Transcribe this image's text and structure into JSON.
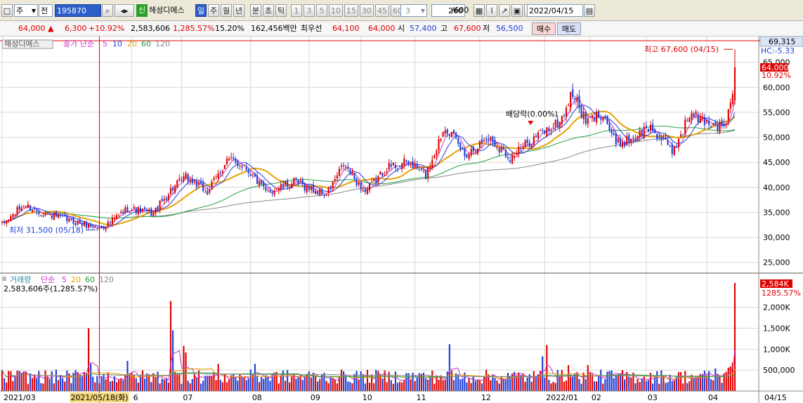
{
  "toolbar": {
    "market": "주",
    "prev_label": "전",
    "code": "195870",
    "badge": "신",
    "name": "해성디에스",
    "periods": [
      "일",
      "주",
      "월",
      "년",
      "분",
      "초",
      "틱"
    ],
    "intervals": [
      "1",
      "3",
      "5",
      "10",
      "15",
      "30",
      "45",
      "60"
    ],
    "count_select": "3",
    "view_count": "260",
    "view_total": "/600",
    "date": "2022/04/15"
  },
  "quote": {
    "price": "64,000",
    "change_arrow": "▲",
    "change": "6,300",
    "change_pct": "+10.92%",
    "volume": "2,583,606",
    "volume_pct": "1,285.57%",
    "turnover": "15.20%",
    "amount": "162,456백만",
    "best_label": "최우선",
    "best_ask": "64,100",
    "best_bid": "64,000",
    "open_label": "시",
    "open": "57,400",
    "high_label": "고",
    "high": "67,600",
    "low_label": "저",
    "low": "56,500",
    "buy": "매수",
    "sell": "매도"
  },
  "colors": {
    "up": "#e00000",
    "down": "#1f3fd6",
    "ma5": "#cc33cc",
    "ma10": "#1f3fd6",
    "ma20": "#e8a000",
    "ma60": "#22a040",
    "ma120": "#888888",
    "highlight": "#e00000"
  },
  "price_panel": {
    "legend_name": "해성디에스",
    "legend_type": "종가 단순",
    "ma_periods": [
      "5",
      "10",
      "20",
      "60",
      "120"
    ],
    "hover_label": "69,315",
    "hc_label": "HC:-5.33",
    "last_label": "64,000",
    "last_pct": "10.92%",
    "high_annotation": "최고 67,600 (04/15)",
    "low_annotation": "최저 31,500 (05/18)",
    "dividend_annotation": "배당락(0.00%)"
  },
  "volume_panel": {
    "legend_name": "거래량",
    "legend_type": "단순",
    "ma_periods": [
      "5",
      "20",
      "60",
      "120"
    ],
    "value_text": "2,583,606주(1,285.57%)",
    "last_label": "2,584K",
    "last_pct": "1285.57%"
  },
  "x_axis": {
    "highlight_date": "2021/05/18(화)",
    "end_label": "04/15"
  },
  "chart_data": {
    "type": "candlestick",
    "title": "해성디에스",
    "y_axis": {
      "ticks": [
        25000,
        30000,
        35000,
        40000,
        45000,
        50000,
        55000,
        60000,
        65000
      ],
      "labels": [
        "25,000",
        "30,000",
        "35,000",
        "40,000",
        "45,000",
        "50,000",
        "55,000",
        "60,000",
        "65,000"
      ],
      "ylim": [
        23000,
        69315
      ]
    },
    "x_axis_labels": [
      {
        "label": "2021/03",
        "index": 0
      },
      {
        "label": "6",
        "index": 60
      },
      {
        "label": "07",
        "index": 83
      },
      {
        "label": "08",
        "index": 115
      },
      {
        "label": "09",
        "index": 142
      },
      {
        "label": "10",
        "index": 166
      },
      {
        "label": "11",
        "index": 191
      },
      {
        "label": "12",
        "index": 221
      },
      {
        "label": "2022/01",
        "index": 251
      },
      {
        "label": "02",
        "index": 272
      },
      {
        "label": "03",
        "index": 298
      },
      {
        "label": "04",
        "index": 326
      }
    ],
    "highlight_index": 45,
    "dividend_index": 251,
    "anchors": [
      [
        0,
        32500
      ],
      [
        10,
        36500
      ],
      [
        18,
        35000
      ],
      [
        30,
        33500
      ],
      [
        45,
        31800
      ],
      [
        50,
        33000
      ],
      [
        58,
        35800
      ],
      [
        70,
        34800
      ],
      [
        78,
        39500
      ],
      [
        85,
        42000
      ],
      [
        95,
        39000
      ],
      [
        104,
        45500
      ],
      [
        112,
        44500
      ],
      [
        122,
        39000
      ],
      [
        135,
        41000
      ],
      [
        150,
        38500
      ],
      [
        158,
        44500
      ],
      [
        168,
        39000
      ],
      [
        178,
        44000
      ],
      [
        188,
        45000
      ],
      [
        196,
        42500
      ],
      [
        205,
        52500
      ],
      [
        214,
        46500
      ],
      [
        225,
        50000
      ],
      [
        235,
        46000
      ],
      [
        248,
        50500
      ],
      [
        258,
        53000
      ],
      [
        264,
        59000
      ],
      [
        270,
        53000
      ],
      [
        278,
        55000
      ],
      [
        284,
        48500
      ],
      [
        292,
        50000
      ],
      [
        300,
        52000
      ],
      [
        310,
        47000
      ],
      [
        318,
        54500
      ],
      [
        330,
        52500
      ],
      [
        334,
        52000
      ],
      [
        338,
        57700
      ],
      [
        339,
        64000
      ]
    ],
    "last_candle": {
      "open": 57400,
      "high": 67600,
      "low": 56500,
      "close": 64000
    },
    "high": {
      "value": 67600,
      "date": "04/15"
    },
    "low": {
      "value": 31500,
      "date": "05/18"
    },
    "volume": {
      "y_axis": {
        "ticks": [
          500000,
          1000000,
          1500000,
          2000000
        ],
        "labels": [
          "500,000",
          "1,000K",
          "1,500K",
          "2,000K"
        ],
        "ylim": [
          0,
          2800000
        ]
      },
      "base": 380000,
      "spikes": [
        [
          40,
          1500000
        ],
        [
          41,
          650000
        ],
        [
          58,
          720000
        ],
        [
          78,
          2150000
        ],
        [
          79,
          1450000
        ],
        [
          84,
          1080000
        ],
        [
          85,
          920000
        ],
        [
          100,
          650000
        ],
        [
          117,
          650000
        ],
        [
          207,
          1120000
        ],
        [
          250,
          830000
        ],
        [
          252,
          1100000
        ],
        [
          262,
          620000
        ],
        [
          271,
          620000
        ],
        [
          330,
          540000
        ],
        [
          336,
          560000
        ],
        [
          337,
          590000
        ],
        [
          338,
          680000
        ],
        [
          339,
          2583606
        ]
      ]
    }
  }
}
